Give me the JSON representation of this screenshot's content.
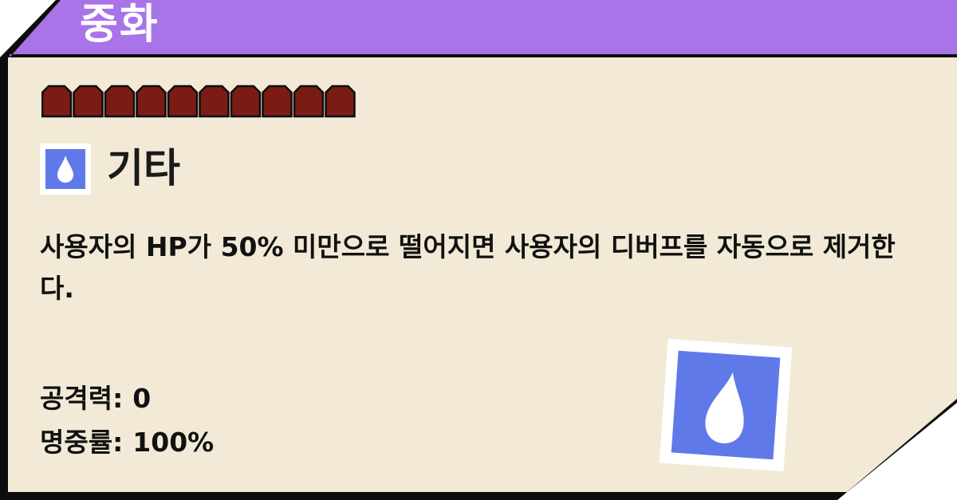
{
  "move": {
    "name": "중화",
    "pp_count": 10,
    "type": {
      "label": "기타",
      "icon": "water-drop-icon"
    },
    "description": "사용자의 HP가 50% 미만으로 떨어지면 사용자의 디버프를 자동으로 제거한다.",
    "stats": {
      "power_label": "공격력:",
      "power_value": "0",
      "accuracy_label": "명중률:",
      "accuracy_value": "100%"
    }
  },
  "colors": {
    "header": "#a874e8",
    "card_bg": "#f2ead6",
    "border": "#0d0d0d",
    "pp_fill": "#7a1c14",
    "type_icon": "#5f7ae8"
  }
}
